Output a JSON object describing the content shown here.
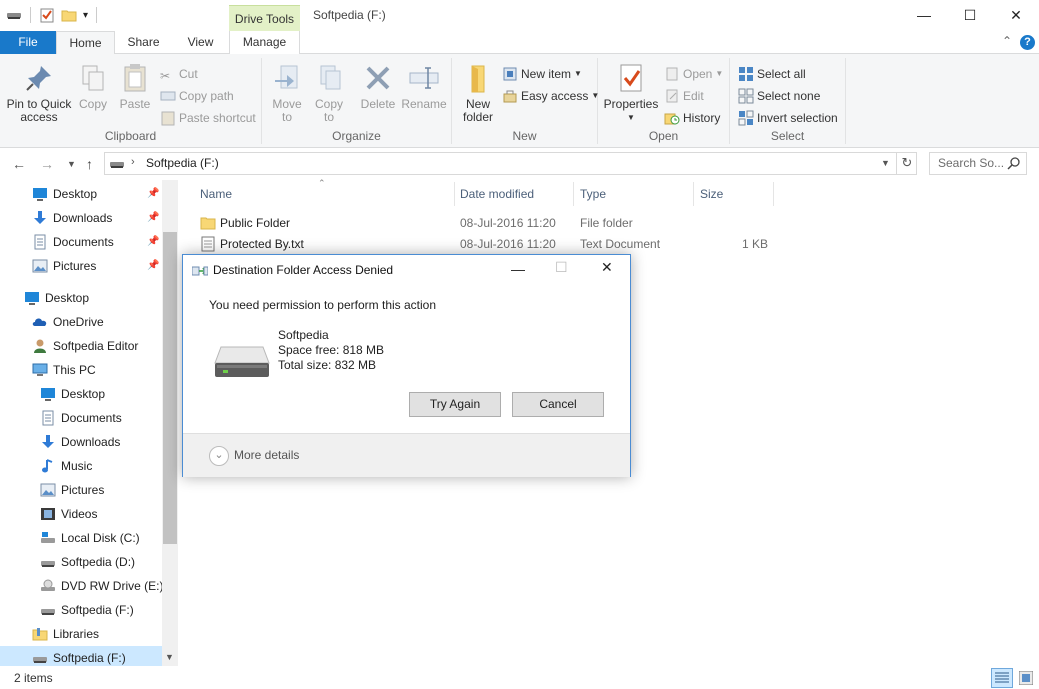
{
  "window": {
    "title": "Softpedia (F:)",
    "context_tab": "Drive Tools",
    "minimize": "—",
    "maximize": "☐",
    "close": "✕"
  },
  "tabs": {
    "file": "File",
    "home": "Home",
    "share": "Share",
    "view": "View",
    "manage": "Manage",
    "collapse": "⌃",
    "help": "?"
  },
  "ribbon": {
    "clipboard": {
      "label": "Clipboard",
      "pin_line1": "Pin to Quick",
      "pin_line2": "access",
      "copy": "Copy",
      "paste": "Paste",
      "cut": "Cut",
      "copy_path": "Copy path",
      "paste_shortcut": "Paste shortcut"
    },
    "organize": {
      "label": "Organize",
      "move_line1": "Move",
      "move_line2": "to",
      "copy_line1": "Copy",
      "copy_line2": "to",
      "delete": "Delete",
      "rename": "Rename"
    },
    "new": {
      "label": "New",
      "folder_line1": "New",
      "folder_line2": "folder",
      "new_item": "New item",
      "easy_access": "Easy access"
    },
    "open": {
      "label": "Open",
      "properties": "Properties",
      "open": "Open",
      "edit": "Edit",
      "history": "History"
    },
    "select": {
      "label": "Select",
      "select_all": "Select all",
      "select_none": "Select none",
      "invert": "Invert selection"
    }
  },
  "address": {
    "path": "Softpedia (F:)",
    "search_placeholder": "Search So..."
  },
  "nav": {
    "quick": [
      {
        "label": "Desktop"
      },
      {
        "label": "Downloads"
      },
      {
        "label": "Documents"
      },
      {
        "label": "Pictures"
      }
    ],
    "tree": [
      {
        "label": "Desktop"
      },
      {
        "label": "OneDrive"
      },
      {
        "label": "Softpedia Editor"
      },
      {
        "label": "This PC"
      },
      {
        "label": "Desktop"
      },
      {
        "label": "Documents"
      },
      {
        "label": "Downloads"
      },
      {
        "label": "Music"
      },
      {
        "label": "Pictures"
      },
      {
        "label": "Videos"
      },
      {
        "label": "Local Disk (C:)"
      },
      {
        "label": "Softpedia (D:)"
      },
      {
        "label": "DVD RW Drive (E:)"
      },
      {
        "label": "Softpedia (F:)"
      },
      {
        "label": "Libraries"
      },
      {
        "label": "Softpedia (F:)"
      }
    ]
  },
  "columns": {
    "name": "Name",
    "date": "Date modified",
    "type": "Type",
    "size": "Size"
  },
  "files": [
    {
      "name": "Public Folder",
      "date": "08-Jul-2016 11:20",
      "type": "File folder",
      "size": ""
    },
    {
      "name": "Protected By.txt",
      "date": "08-Jul-2016 11:20",
      "type": "Text Document",
      "size": "1 KB"
    }
  ],
  "status": {
    "items": "2 items"
  },
  "dialog": {
    "title": "Destination Folder Access Denied",
    "message": "You need permission to perform this action",
    "drive_name": "Softpedia",
    "space_free": "Space free: 818 MB",
    "total_size": "Total size: 832 MB",
    "try_again": "Try Again",
    "cancel": "Cancel",
    "more_details": "More details"
  },
  "colors": {
    "accent": "#1979ca",
    "context_tab": "#e3f1c7",
    "selection": "#cce8ff"
  }
}
